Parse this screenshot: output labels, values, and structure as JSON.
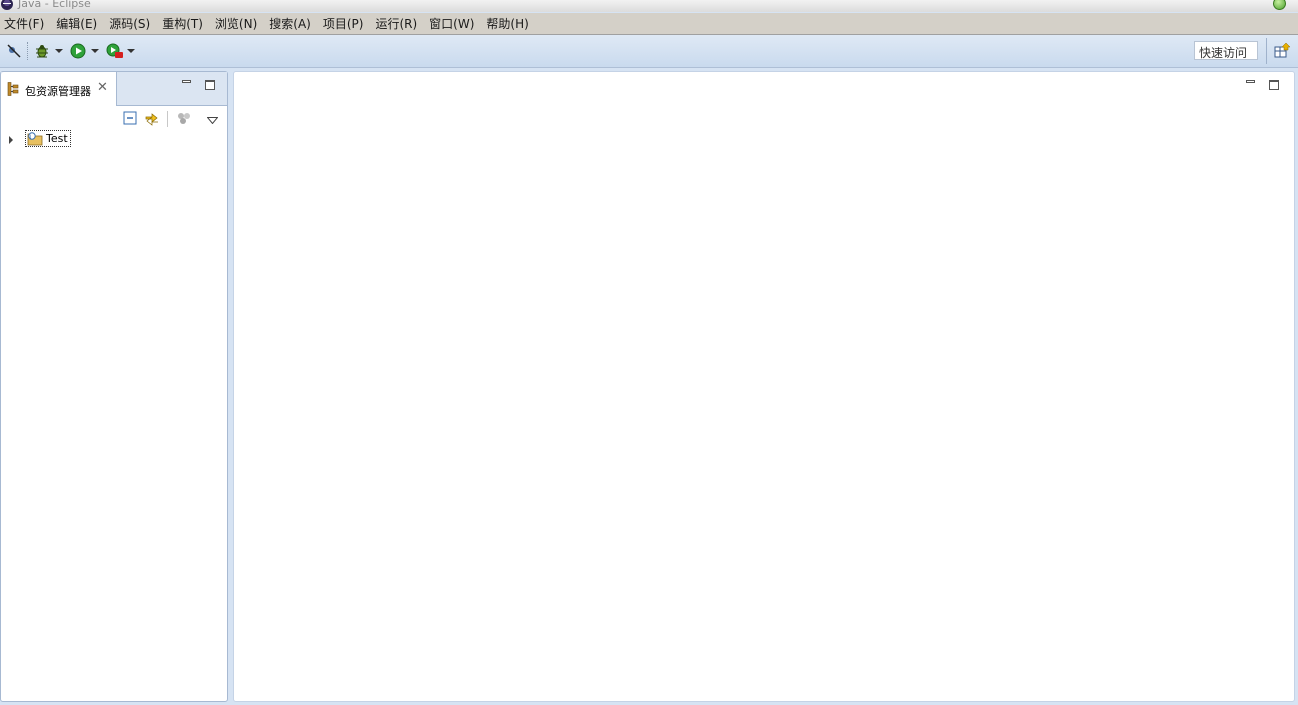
{
  "window": {
    "title": "Java - Eclipse"
  },
  "menu": [
    {
      "label": "文件(F)"
    },
    {
      "label": "编辑(E)"
    },
    {
      "label": "源码(S)"
    },
    {
      "label": "重构(T)"
    },
    {
      "label": "浏览(N)"
    },
    {
      "label": "搜索(A)"
    },
    {
      "label": "项目(P)"
    },
    {
      "label": "运行(R)"
    },
    {
      "label": "窗口(W)"
    },
    {
      "label": "帮助(H)"
    }
  ],
  "toolbar": {
    "quick_access_label": "快速访问"
  },
  "package_explorer": {
    "tab_label": "包资源管理器",
    "close_symbol": "✕",
    "tree": [
      {
        "label": "Test",
        "expanded": false
      }
    ]
  },
  "colors": {
    "toolbar_bg": "#c9daee",
    "menubar_bg": "#d4d0c8",
    "panel_border": "#a7b9d2",
    "run_green": "#2fa23a",
    "error_red": "#d42020"
  }
}
